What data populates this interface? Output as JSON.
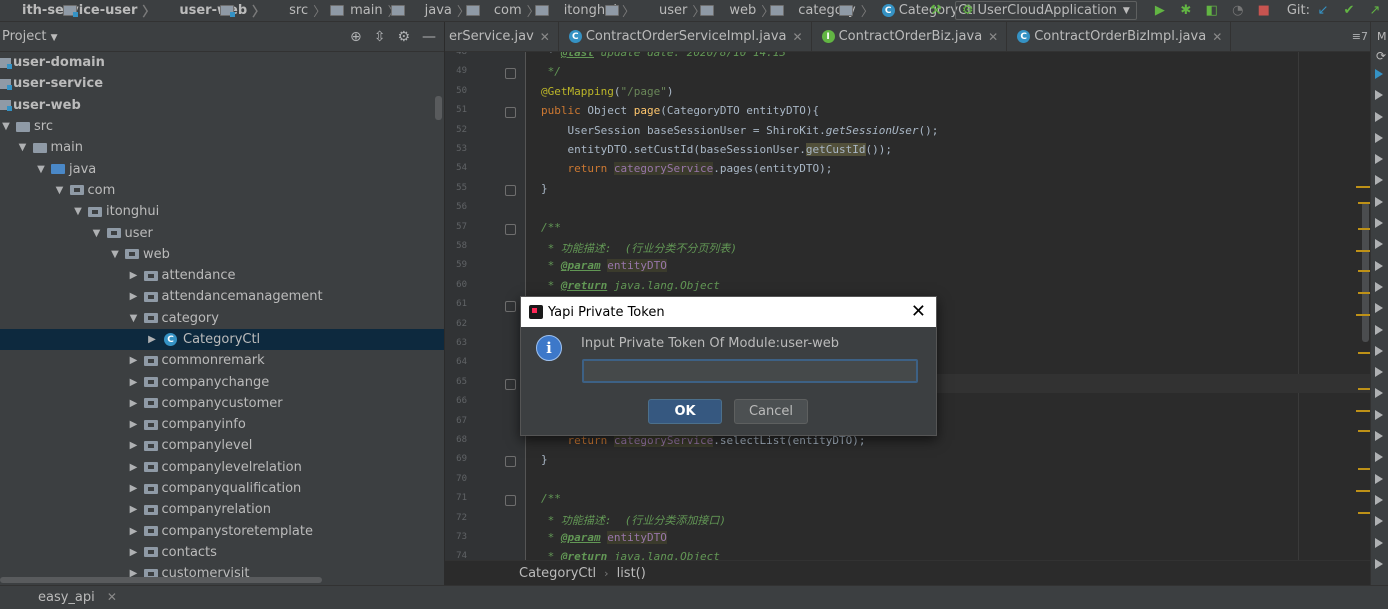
{
  "navbar": {
    "crumbs": [
      "ith-service-user",
      "user-web",
      "src",
      "main",
      "java",
      "com",
      "itonghui",
      "user",
      "web",
      "category"
    ],
    "current_class": "CategoryCtl",
    "run_config": "UserCloudApplication",
    "git_label": "Git:"
  },
  "project_panel": {
    "title": "Project",
    "tree": [
      {
        "label": "user-domain",
        "type": "module",
        "indent": 0
      },
      {
        "label": "user-service",
        "type": "module",
        "indent": 0
      },
      {
        "label": "user-web",
        "type": "module",
        "indent": 0
      },
      {
        "label": "src",
        "type": "folder",
        "indent": 0,
        "expanded": true
      },
      {
        "label": "main",
        "type": "folder",
        "indent": 1,
        "expanded": true
      },
      {
        "label": "java",
        "type": "src",
        "indent": 2,
        "expanded": true
      },
      {
        "label": "com",
        "type": "pkg",
        "indent": 3,
        "expanded": true
      },
      {
        "label": "itonghui",
        "type": "pkg",
        "indent": 4,
        "expanded": true
      },
      {
        "label": "user",
        "type": "pkg",
        "indent": 5,
        "expanded": true
      },
      {
        "label": "web",
        "type": "pkg",
        "indent": 6,
        "expanded": true
      },
      {
        "label": "attendance",
        "type": "pkg",
        "indent": 7,
        "expanded": false
      },
      {
        "label": "attendancemanagement",
        "type": "pkg",
        "indent": 7,
        "expanded": false
      },
      {
        "label": "category",
        "type": "pkg",
        "indent": 7,
        "expanded": true
      },
      {
        "label": "CategoryCtl",
        "type": "class",
        "indent": 8,
        "expanded": false,
        "selected": true
      },
      {
        "label": "commonremark",
        "type": "pkg",
        "indent": 7,
        "expanded": false
      },
      {
        "label": "companychange",
        "type": "pkg",
        "indent": 7,
        "expanded": false
      },
      {
        "label": "companycustomer",
        "type": "pkg",
        "indent": 7,
        "expanded": false
      },
      {
        "label": "companyinfo",
        "type": "pkg",
        "indent": 7,
        "expanded": false
      },
      {
        "label": "companylevel",
        "type": "pkg",
        "indent": 7,
        "expanded": false
      },
      {
        "label": "companylevelrelation",
        "type": "pkg",
        "indent": 7,
        "expanded": false
      },
      {
        "label": "companyqualification",
        "type": "pkg",
        "indent": 7,
        "expanded": false
      },
      {
        "label": "companyrelation",
        "type": "pkg",
        "indent": 7,
        "expanded": false
      },
      {
        "label": "companystoretemplate",
        "type": "pkg",
        "indent": 7,
        "expanded": false
      },
      {
        "label": "contacts",
        "type": "pkg",
        "indent": 7,
        "expanded": false
      },
      {
        "label": "customervisit",
        "type": "pkg",
        "indent": 7,
        "expanded": false
      }
    ]
  },
  "tabs": [
    {
      "label": "erService.jav",
      "icon": "none"
    },
    {
      "label": "ContractOrderServiceImpl.java",
      "icon": "class"
    },
    {
      "label": "ContractOrderBiz.java",
      "icon": "interface"
    },
    {
      "label": "ContractOrderBizImpl.java",
      "icon": "class"
    }
  ],
  "tab_count": "7",
  "editor": {
    "line_numbers": [
      "48",
      "49",
      "50",
      "51",
      "52",
      "53",
      "54",
      "55",
      "56",
      "57",
      "58",
      "59",
      "60",
      "61",
      "62",
      "63",
      "64",
      "65",
      "66",
      "67",
      "68",
      "69",
      "70",
      "71",
      "72",
      "73",
      "74"
    ],
    "lines": [
      " * @last update date: 2020/8/10 14:13",
      " */",
      "@GetMapping(\"/page\")",
      "public Object page(CategoryDTO entityDTO){",
      "    UserSession baseSessionUser = ShiroKit.getSessionUser();",
      "    entityDTO.setCustId(baseSessionUser.getCustId());",
      "    return categoryService.pages(entityDTO);",
      "}",
      "",
      "/**",
      " * 功能描述:  (行业分类不分页列表)",
      " * @param entityDTO",
      " * @return java.lang.Object",
      "",
      "",
      "",
      "",
      "",
      "",
      "",
      "    return categoryService.selectList(entityDTO);",
      "}",
      "",
      "/**",
      " * 功能描述:  (行业分类添加接口)",
      " * @param entityDTO",
      " * @return java.lang.Object"
    ]
  },
  "breadcrumb_bar": {
    "class": "CategoryCtl",
    "method": "list()"
  },
  "bottom_tab": "easy_api",
  "dialog": {
    "title": "Yapi Private Token",
    "message": "Input Private Token Of Module:user-web",
    "input_value": "",
    "ok_label": "OK",
    "cancel_label": "Cancel"
  }
}
